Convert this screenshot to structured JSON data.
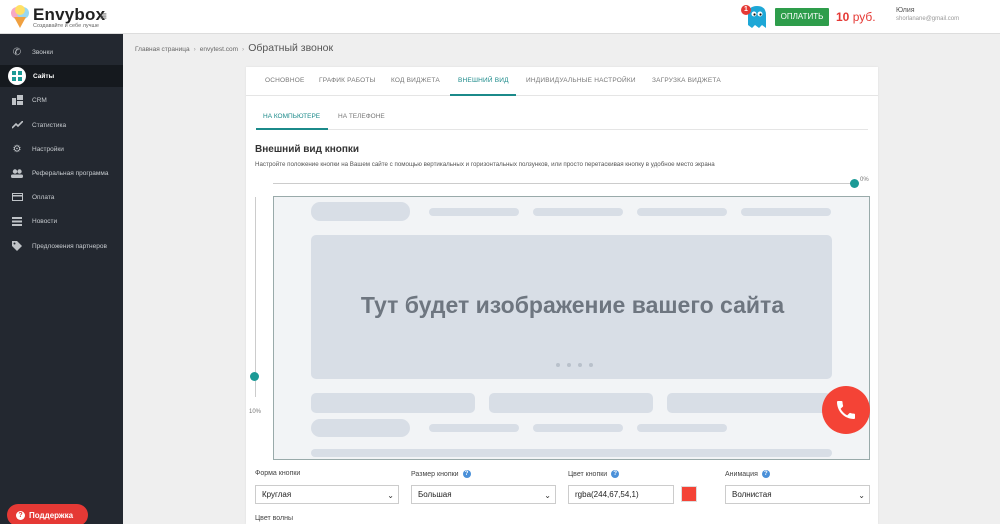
{
  "brand": {
    "name": "Envybox",
    "tagline": "Создавайте и себе лучше"
  },
  "topbar": {
    "notification_count": "1",
    "pay_label": "ОПЛАТИТЬ",
    "balance_amount": "10",
    "balance_currency": "руб.",
    "user_name": "Юлия",
    "user_email": "shorlanane@gmail.com"
  },
  "sidebar": {
    "items": [
      {
        "label": "Звонки",
        "icon": "phone-icon"
      },
      {
        "label": "Сайты",
        "icon": "sites-icon",
        "active": true
      },
      {
        "label": "CRM",
        "icon": "crm-icon"
      },
      {
        "label": "Статистика",
        "icon": "stats-icon"
      },
      {
        "label": "Настройки",
        "icon": "gear-icon"
      },
      {
        "label": "Реферальная программа",
        "icon": "people-icon"
      },
      {
        "label": "Оплата",
        "icon": "payment-icon"
      },
      {
        "label": "Новости",
        "icon": "news-icon"
      },
      {
        "label": "Предложения партнеров",
        "icon": "tag-icon"
      }
    ],
    "support_label": "Поддержка"
  },
  "breadcrumb": {
    "home": "Главная страница",
    "site": "envytest.com",
    "current": "Обратный звонок"
  },
  "tabs": [
    "ОСНОВНОЕ",
    "ГРАФИК РАБОТЫ",
    "КОД ВИДЖЕТА",
    "ВНЕШНИЙ ВИД",
    "ИНДИВИДУАЛЬНЫЕ НАСТРОЙКИ",
    "ЗАГРУЗКА ВИДЖЕТА"
  ],
  "active_tab": "ВНЕШНИЙ ВИД",
  "subtabs": [
    "НА КОМПЬЮТЕРЕ",
    "НА ТЕЛЕФОНЕ"
  ],
  "active_subtab": "НА КОМПЬЮТЕРЕ",
  "section": {
    "title": "Внешний вид кнопки",
    "description": "Настройте положение кнопки на Вашем сайте с помощью вертикальных и горизонтальных ползунков, или просто перетаскивая кнопку в удобное место экрана"
  },
  "sliders": {
    "horizontal_value": "0%",
    "vertical_value": "10%"
  },
  "preview": {
    "placeholder_text": "Тут будет изображение вашего сайта"
  },
  "form": {
    "shape_label": "Форма кнопки",
    "shape_value": "Круглая",
    "size_label": "Размер кнопки",
    "size_value": "Большая",
    "color_label": "Цвет кнопки",
    "color_value": "rgba(244,67,54,1)",
    "animation_label": "Анимация",
    "animation_value": "Волнистая",
    "wave_color_label": "Цвет волны"
  },
  "colors": {
    "accent": "#1b8a8a",
    "call_button": "#f44336",
    "pay_button": "#2e9d4b",
    "sidebar": "#232830"
  }
}
